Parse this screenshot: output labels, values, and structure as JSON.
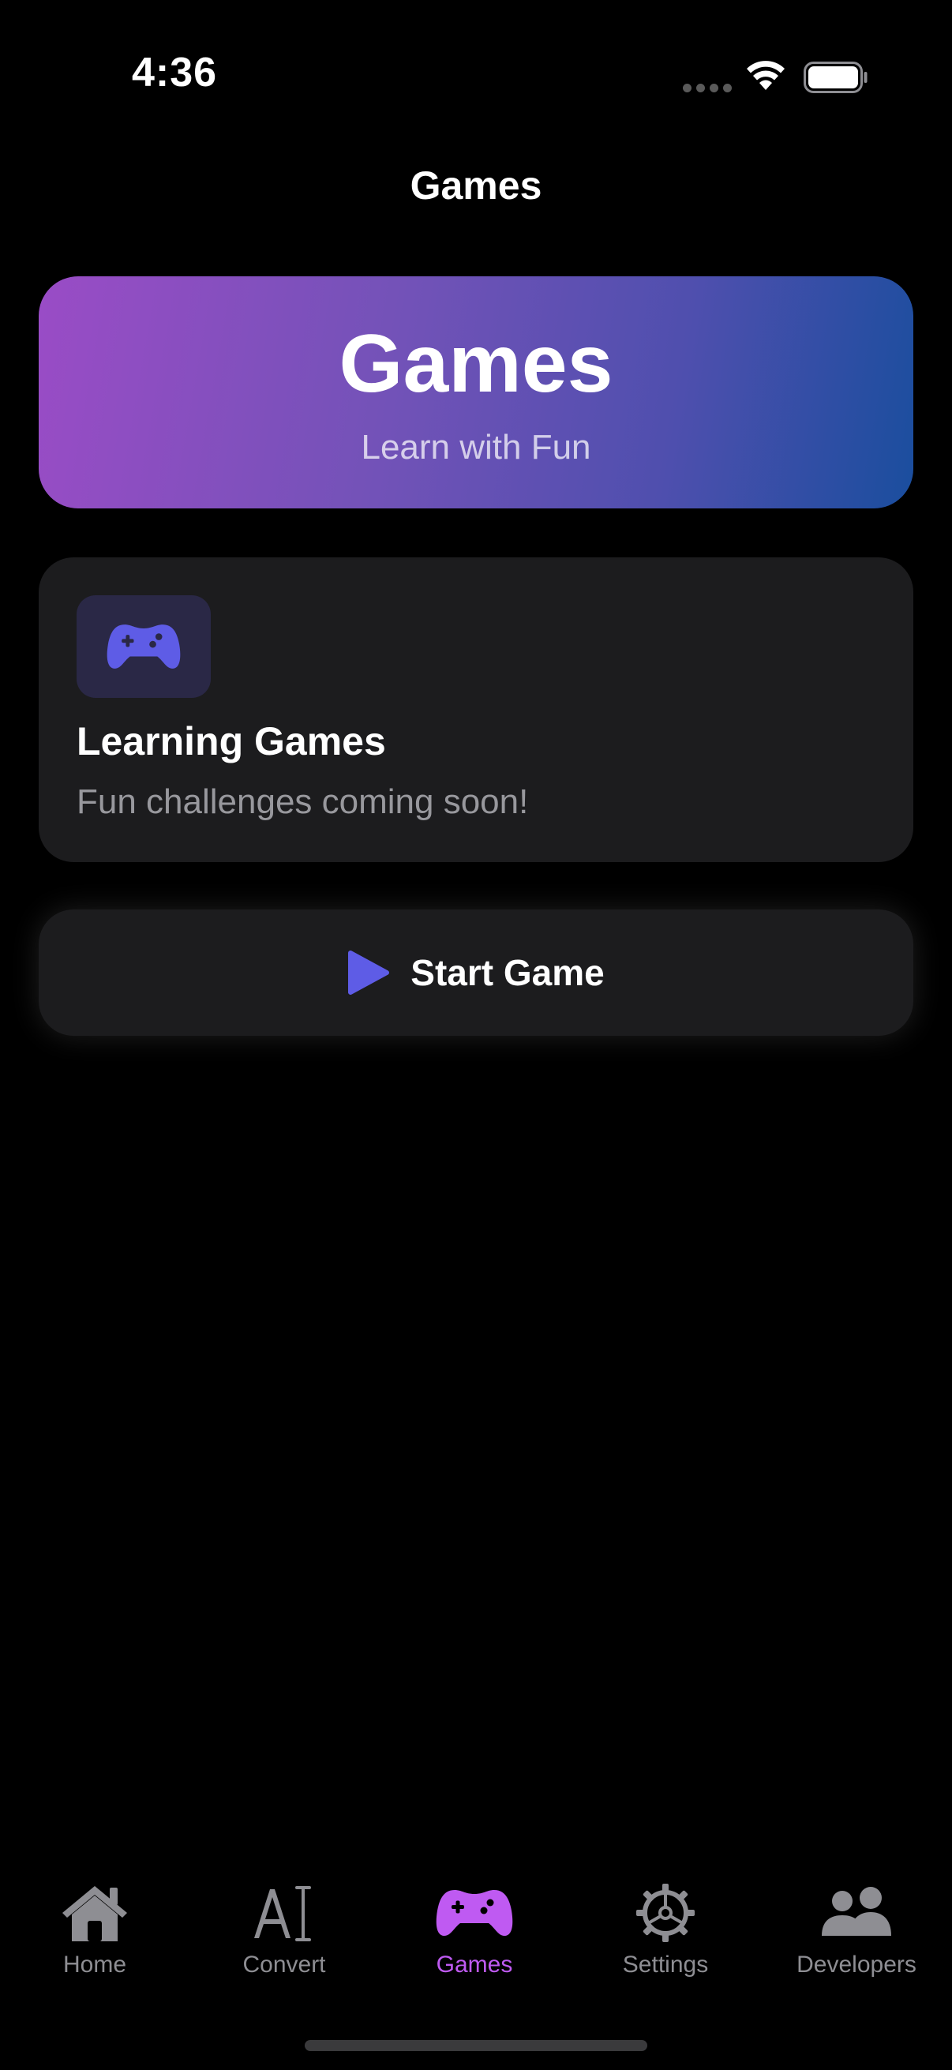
{
  "status_bar": {
    "time": "4:36"
  },
  "nav": {
    "title": "Games"
  },
  "hero": {
    "title": "Games",
    "subtitle": "Learn with Fun"
  },
  "info_card": {
    "icon": "gamecontroller-icon",
    "title": "Learning Games",
    "subtitle": "Fun challenges coming soon!"
  },
  "start_button": {
    "icon": "play-icon",
    "label": "Start Game"
  },
  "tab_bar": {
    "items": [
      {
        "label": "Home",
        "icon": "house-icon"
      },
      {
        "label": "Convert",
        "icon": "text-cursor-icon"
      },
      {
        "label": "Games",
        "icon": "gamecontroller-icon",
        "active": true
      },
      {
        "label": "Settings",
        "icon": "gear-icon"
      },
      {
        "label": "Developers",
        "icon": "people-icon"
      }
    ]
  },
  "colors": {
    "background": "#000000",
    "card": "#1c1c1e",
    "accent_purple": "#bf5af2",
    "icon_indigo": "#5e5ce6",
    "secondary_text": "#98989d",
    "inactive_tab": "#8e8e93"
  }
}
